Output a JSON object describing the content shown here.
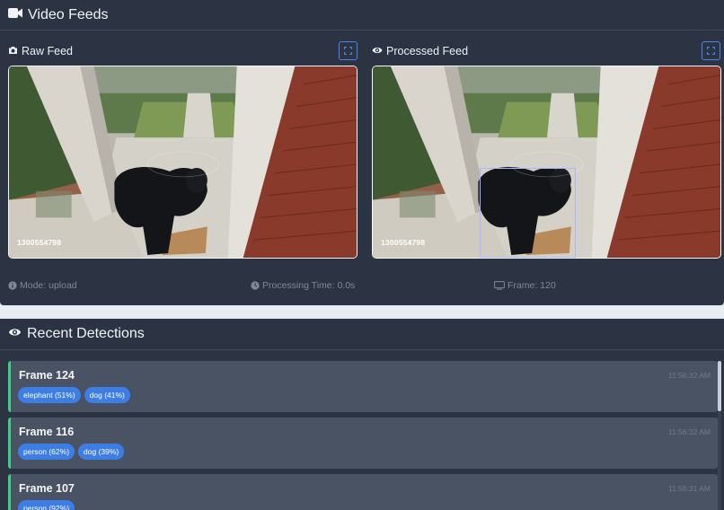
{
  "video_feeds": {
    "title": "Video Feeds",
    "raw": {
      "title": "Raw Feed",
      "camera_id": "1300554798"
    },
    "processed": {
      "title": "Processed Feed",
      "camera_id": "1300554798"
    },
    "status": {
      "mode": "Mode: upload",
      "processing_time": "Processing Time: 0.0s",
      "frame": "Frame: 120"
    }
  },
  "recent_detections": {
    "title": "Recent Detections",
    "items": [
      {
        "frame": "Frame 124",
        "time": "11:56:32 AM",
        "tags": [
          "elephant (51%)",
          "dog (41%)"
        ]
      },
      {
        "frame": "Frame 116",
        "time": "11:56:32 AM",
        "tags": [
          "person (62%)",
          "dog (39%)"
        ]
      },
      {
        "frame": "Frame 107",
        "time": "11:56:31 AM",
        "tags": [
          "person (92%)"
        ]
      }
    ]
  },
  "colors": {
    "panel": "#2c3444",
    "item_bg": "#4a5363",
    "accent_blue": "#3d7ee6",
    "accent_green": "#3ccf8a"
  },
  "icons": [
    "video-camera-icon",
    "camera-icon",
    "eye-icon",
    "expand-icon",
    "info-icon",
    "clock-icon",
    "monitor-icon"
  ]
}
